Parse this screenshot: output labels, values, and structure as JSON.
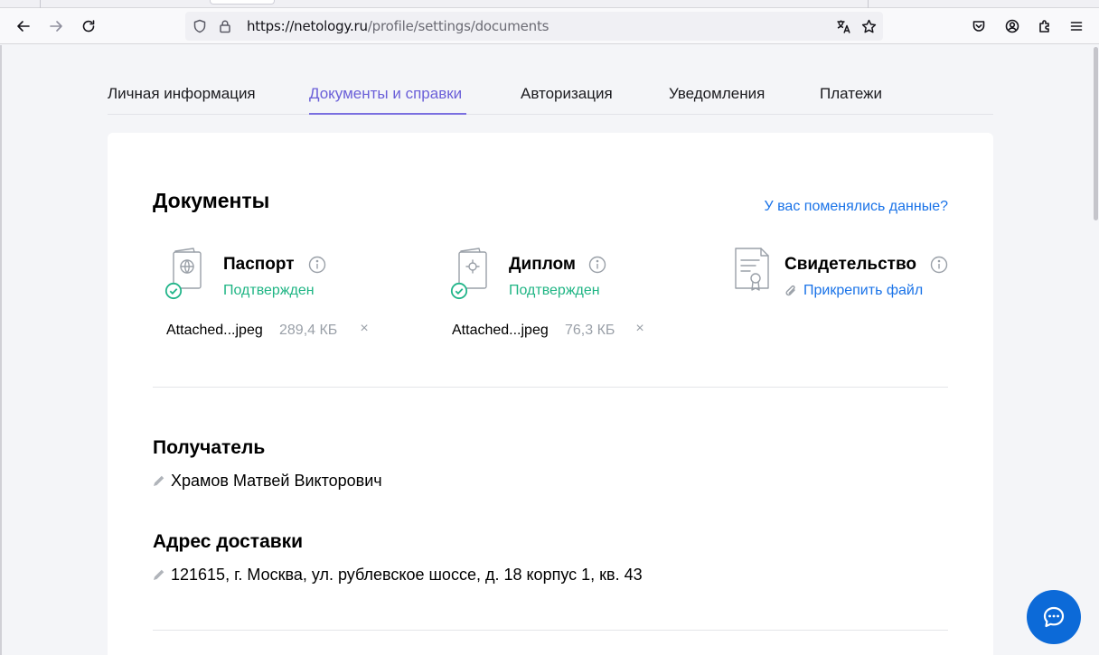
{
  "browser": {
    "url_host": "https://netology.ru",
    "url_path": "/profile/settings/documents"
  },
  "tabs": [
    {
      "label": "Личная информация",
      "active": false
    },
    {
      "label": "Документы и справки",
      "active": true
    },
    {
      "label": "Авторизация",
      "active": false
    },
    {
      "label": "Уведомления",
      "active": false
    },
    {
      "label": "Платежи",
      "active": false
    }
  ],
  "documents": {
    "title": "Документы",
    "changed_link": "У вас поменялись данные?",
    "items": [
      {
        "name": "Паспорт",
        "status": "Подтвержден",
        "file_name": "Attached...jpeg",
        "file_size": "289,4 КБ",
        "remove": "×",
        "icon": "passport-icon"
      },
      {
        "name": "Диплом",
        "status": "Подтвержден",
        "file_name": "Attached...jpeg",
        "file_size": "76,3 КБ",
        "remove": "×",
        "icon": "diploma-icon"
      },
      {
        "name": "Свидетельство",
        "attach_label": "Прикрепить файл",
        "icon": "certificate-icon"
      }
    ]
  },
  "recipient": {
    "title": "Получатель",
    "value": "Храмов Матвей Викторович"
  },
  "address": {
    "title": "Адрес доставки",
    "value": "121615, г. Москва, ул. рублевское шоссе, д. 18 корпус 1, кв. 43"
  },
  "colors": {
    "accent": "#6a5fd8",
    "link": "#1a73e8",
    "success": "#1fb584",
    "chat": "#0c6ad8"
  }
}
